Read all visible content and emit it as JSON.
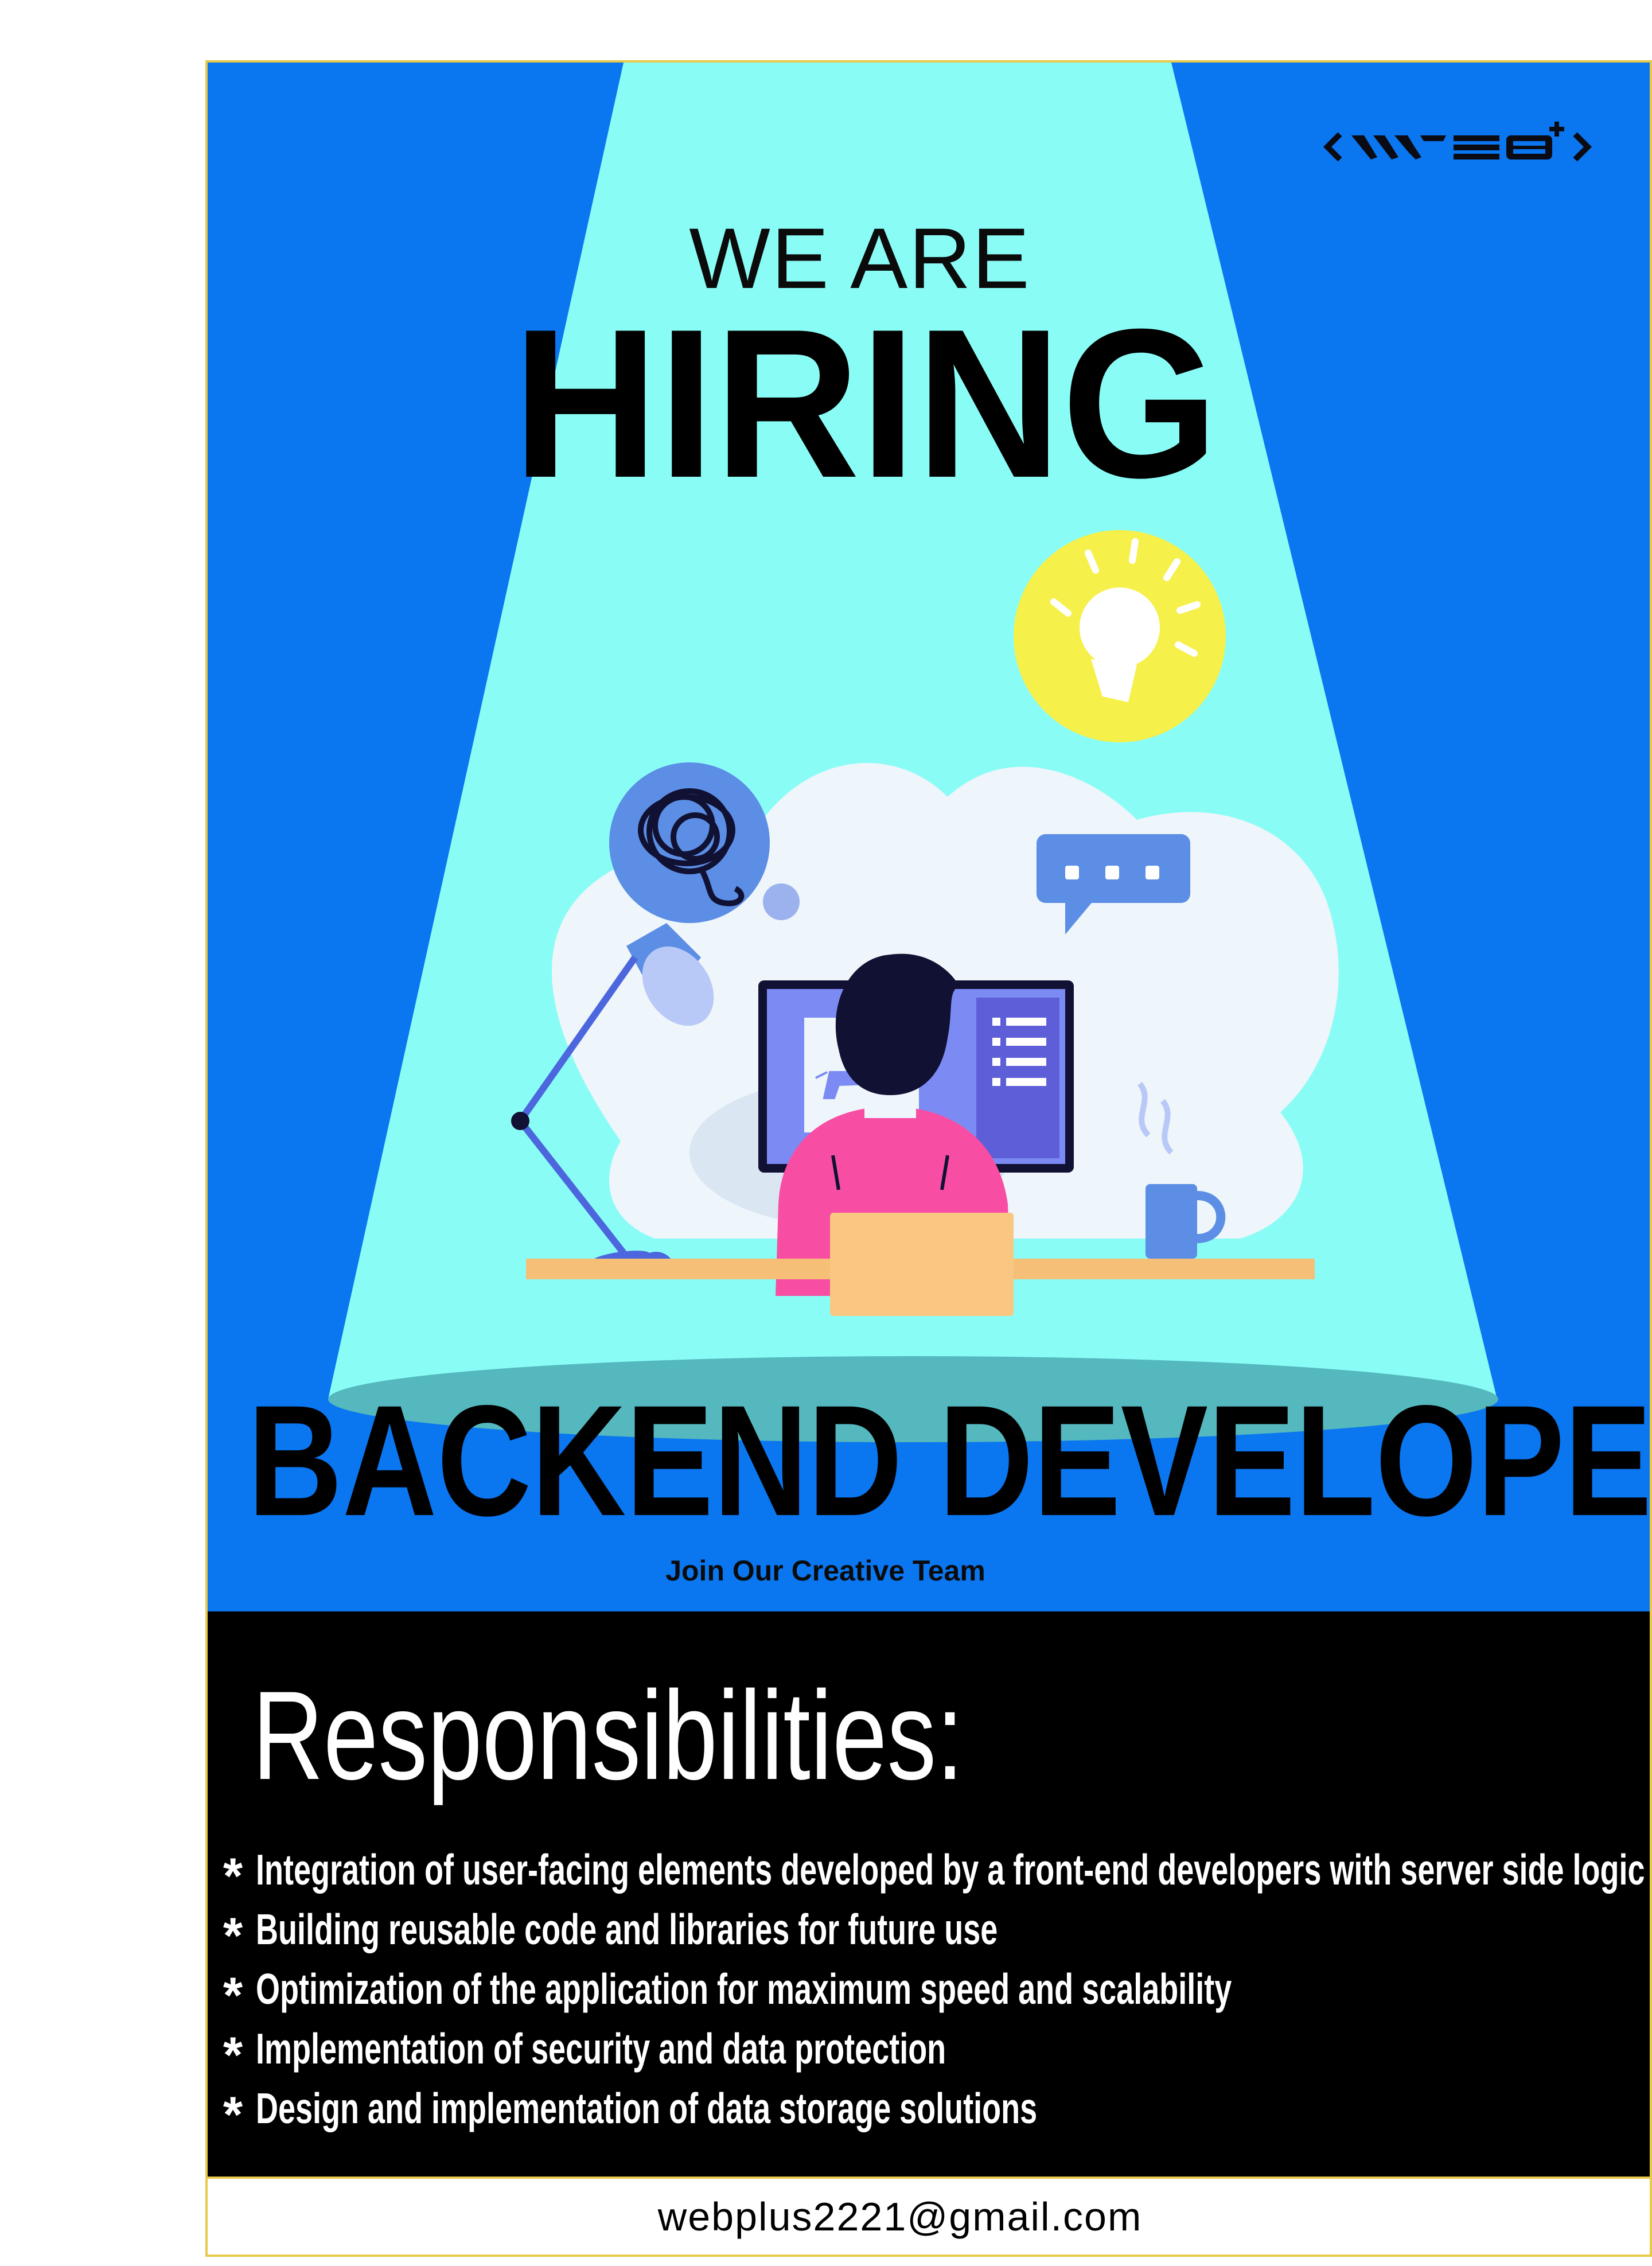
{
  "brand": {
    "logo_text": "<WEB+>"
  },
  "hero": {
    "kicker": "WE ARE",
    "headline": "HIRING",
    "role": "BACKEND DEVELOPER",
    "tagline": "Join Our Creative Team"
  },
  "responsibilities": {
    "title": "Responsibilities:",
    "bullet": "*",
    "items": [
      "Integration of user-facing elements developed by a front-end developers with server side logic",
      "Building reusable code and libraries for future use",
      "Optimization of the application for maximum speed and scalability",
      "Implementation of security and data protection",
      "Design and implementation of data storage solutions"
    ]
  },
  "contact": {
    "email": "webplus2221@gmail.com"
  },
  "colors": {
    "background_blue": "#0a76f0",
    "spotlight": "#8afcf6",
    "black_band": "#000000",
    "border_yellow": "#e8c94a",
    "shirt_pink": "#f74ea3",
    "bulb_yellow": "#f6f04a"
  },
  "illustration": {
    "icons": [
      "lightbulb-icon",
      "tangled-thought-icon",
      "chat-bubble-icon",
      "desk-lamp-icon",
      "coffee-mug-icon",
      "monitor-icon",
      "horse-image-icon"
    ]
  }
}
